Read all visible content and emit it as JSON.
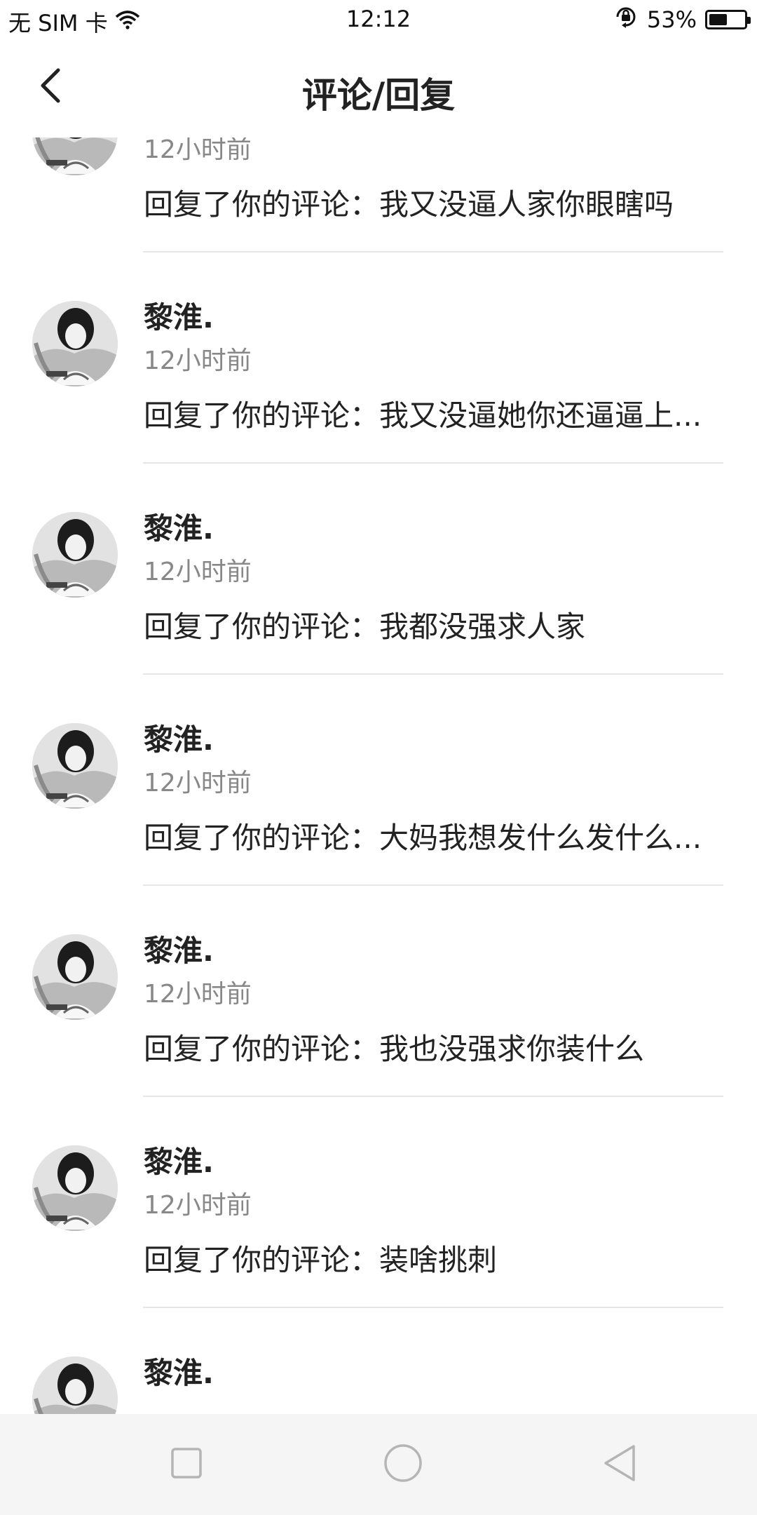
{
  "status_bar": {
    "carrier": "无 SIM 卡",
    "time": "12:12",
    "battery_percent": "53%",
    "battery_level": 0.53,
    "icons": [
      "wifi-icon",
      "rotation-lock-icon",
      "battery-icon"
    ]
  },
  "header": {
    "back_icon": "chevron-left-icon",
    "title": "评论/回复"
  },
  "comments": [
    {
      "name": "黎淮.",
      "time": "12小时前",
      "text": "回复了你的评论：我又没逼人家你眼瞎吗"
    },
    {
      "name": "黎淮.",
      "time": "12小时前",
      "text": "回复了你的评论：我又没逼她你还逼逼上..."
    },
    {
      "name": "黎淮.",
      "time": "12小时前",
      "text": "回复了你的评论：我都没强求人家"
    },
    {
      "name": "黎淮.",
      "time": "12小时前",
      "text": "回复了你的评论：大妈我想发什么发什么..."
    },
    {
      "name": "黎淮.",
      "time": "12小时前",
      "text": "回复了你的评论：我也没强求你装什么"
    },
    {
      "name": "黎淮.",
      "time": "12小时前",
      "text": "回复了你的评论：装啥挑刺"
    },
    {
      "name": "黎淮.",
      "time": "",
      "text": ""
    }
  ],
  "nav_bar": {
    "icons": [
      "recent-apps-icon",
      "home-icon",
      "back-triangle-icon"
    ]
  },
  "colors": {
    "text_primary": "#222222",
    "text_secondary": "#888888",
    "divider": "#e6e6e6",
    "nav_background": "#f5f5f5"
  }
}
